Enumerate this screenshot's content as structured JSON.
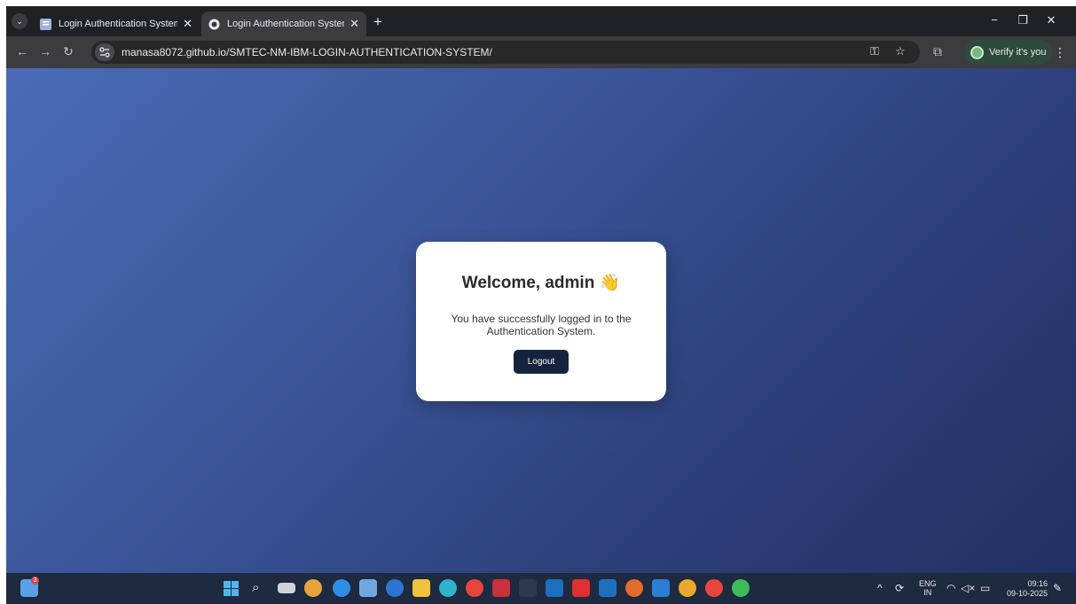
{
  "browser": {
    "tabs": [
      {
        "title": "Login Authentication System: P",
        "active": false
      },
      {
        "title": "Login Authentication System",
        "active": true
      }
    ],
    "new_tab_label": "+",
    "address_bar": {
      "url": "manasa8072.github.io/SMTEC-NM-IBM-LOGIN-AUTHENTICATION-SYSTEM/"
    },
    "profile_button_label": "Verify it's you"
  },
  "page": {
    "welcome_heading": "Welcome, admin 👋",
    "message": "You have successfully logged in to the Authentication System.",
    "logout_label": "Logout",
    "background_gradient": [
      "#4a6bb6",
      "#223063"
    ]
  },
  "taskbar": {
    "notification_badge": "3",
    "language": {
      "line1": "ENG",
      "line2": "IN"
    },
    "clock": {
      "time": "09:16",
      "date": "09-10-2025"
    }
  },
  "colors": {
    "logout_button": "#16233f",
    "card": "#ffffff"
  }
}
